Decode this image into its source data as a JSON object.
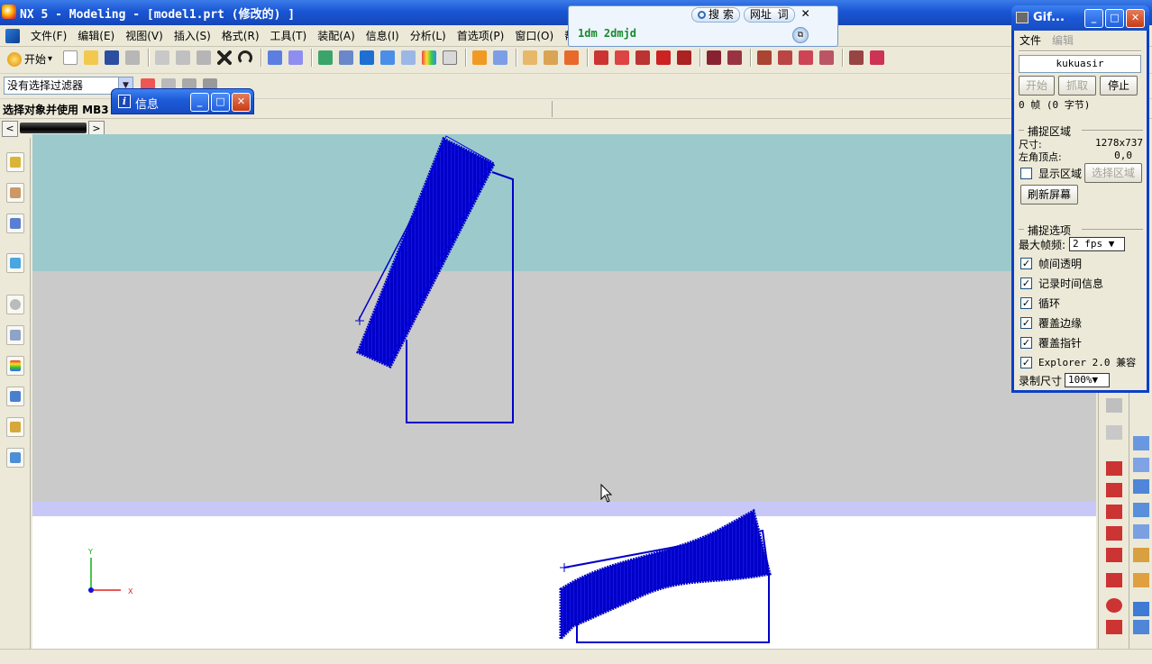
{
  "titlebar": {
    "title": "NX 5 - Modeling - [model1.prt  (修改的) ]"
  },
  "menubar": {
    "items": [
      "文件(F)",
      "编辑(E)",
      "视图(V)",
      "插入(S)",
      "格式(R)",
      "工具(T)",
      "装配(A)",
      "信息(I)",
      "分析(L)",
      "首选项(P)",
      "窗口(O)",
      "帮助(H)"
    ]
  },
  "toolbar": {
    "start_label": "开始",
    "start_arrow": "▾"
  },
  "selection": {
    "filter_value": "没有选择过滤器",
    "filter_arrow": "▼",
    "status_message": "选择对象并使用 MB3"
  },
  "tabs": {
    "left_arrow": "<",
    "right_arrow": ">"
  },
  "info_window": {
    "title": "信息",
    "icon": "i"
  },
  "window_buttons": {
    "minimize": "_",
    "maximize": "□",
    "close": "✕"
  },
  "search_bar": {
    "search_label": "搜 索",
    "url_label": "网址",
    "word_label": "词",
    "close": "✕",
    "query": "1dm 2dmjd"
  },
  "gif_window": {
    "title": "Gif...",
    "menu": {
      "file": "文件",
      "edit": "编辑"
    },
    "user": "kukuasir",
    "buttons": {
      "start": "开始",
      "grab": "抓取",
      "stop": "停止"
    },
    "frames": "0 帧 (0 字节)",
    "capture_area": {
      "heading": "捕捉区域",
      "size_label": "尺寸:",
      "size_value": "1278x737",
      "corner_label": "左角顶点:",
      "corner_value": "0,0",
      "show_area": "显示区域",
      "select_area": "选择区域",
      "refresh": "刷新屏幕"
    },
    "capture_options": {
      "heading": "捕捉选项",
      "max_fps_label": "最大帧频:",
      "max_fps_value": "2 fps ▼",
      "checks": [
        "帧间透明",
        "记录时间信息",
        "循环",
        "覆盖边缘",
        "覆盖指针",
        "Explorer 2.0 兼容"
      ],
      "record_size_label": "录制尺寸",
      "record_size_value": "100%▼"
    },
    "check_mark": "✓"
  },
  "axes": {
    "x_label": "X",
    "y_label": "Y"
  },
  "colors": {
    "model_blue": "#0000c8",
    "teal_band": "#9ccacc",
    "gray_band": "#cacaca",
    "lilac_band": "#c8c8f8",
    "axis_x": "#e02020",
    "axis_y": "#10b010",
    "axis_z": "#1010e0"
  }
}
